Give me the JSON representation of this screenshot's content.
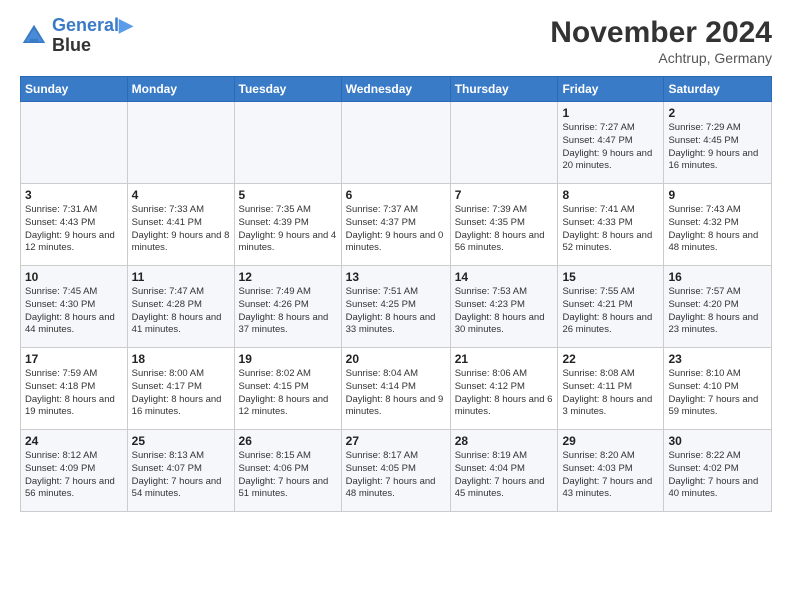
{
  "header": {
    "logo_line1": "General",
    "logo_line2": "Blue",
    "month": "November 2024",
    "location": "Achtrup, Germany"
  },
  "columns": [
    "Sunday",
    "Monday",
    "Tuesday",
    "Wednesday",
    "Thursday",
    "Friday",
    "Saturday"
  ],
  "weeks": [
    [
      {
        "day": "",
        "info": ""
      },
      {
        "day": "",
        "info": ""
      },
      {
        "day": "",
        "info": ""
      },
      {
        "day": "",
        "info": ""
      },
      {
        "day": "",
        "info": ""
      },
      {
        "day": "1",
        "info": "Sunrise: 7:27 AM\nSunset: 4:47 PM\nDaylight: 9 hours and 20 minutes."
      },
      {
        "day": "2",
        "info": "Sunrise: 7:29 AM\nSunset: 4:45 PM\nDaylight: 9 hours and 16 minutes."
      }
    ],
    [
      {
        "day": "3",
        "info": "Sunrise: 7:31 AM\nSunset: 4:43 PM\nDaylight: 9 hours and 12 minutes."
      },
      {
        "day": "4",
        "info": "Sunrise: 7:33 AM\nSunset: 4:41 PM\nDaylight: 9 hours and 8 minutes."
      },
      {
        "day": "5",
        "info": "Sunrise: 7:35 AM\nSunset: 4:39 PM\nDaylight: 9 hours and 4 minutes."
      },
      {
        "day": "6",
        "info": "Sunrise: 7:37 AM\nSunset: 4:37 PM\nDaylight: 9 hours and 0 minutes."
      },
      {
        "day": "7",
        "info": "Sunrise: 7:39 AM\nSunset: 4:35 PM\nDaylight: 8 hours and 56 minutes."
      },
      {
        "day": "8",
        "info": "Sunrise: 7:41 AM\nSunset: 4:33 PM\nDaylight: 8 hours and 52 minutes."
      },
      {
        "day": "9",
        "info": "Sunrise: 7:43 AM\nSunset: 4:32 PM\nDaylight: 8 hours and 48 minutes."
      }
    ],
    [
      {
        "day": "10",
        "info": "Sunrise: 7:45 AM\nSunset: 4:30 PM\nDaylight: 8 hours and 44 minutes."
      },
      {
        "day": "11",
        "info": "Sunrise: 7:47 AM\nSunset: 4:28 PM\nDaylight: 8 hours and 41 minutes."
      },
      {
        "day": "12",
        "info": "Sunrise: 7:49 AM\nSunset: 4:26 PM\nDaylight: 8 hours and 37 minutes."
      },
      {
        "day": "13",
        "info": "Sunrise: 7:51 AM\nSunset: 4:25 PM\nDaylight: 8 hours and 33 minutes."
      },
      {
        "day": "14",
        "info": "Sunrise: 7:53 AM\nSunset: 4:23 PM\nDaylight: 8 hours and 30 minutes."
      },
      {
        "day": "15",
        "info": "Sunrise: 7:55 AM\nSunset: 4:21 PM\nDaylight: 8 hours and 26 minutes."
      },
      {
        "day": "16",
        "info": "Sunrise: 7:57 AM\nSunset: 4:20 PM\nDaylight: 8 hours and 23 minutes."
      }
    ],
    [
      {
        "day": "17",
        "info": "Sunrise: 7:59 AM\nSunset: 4:18 PM\nDaylight: 8 hours and 19 minutes."
      },
      {
        "day": "18",
        "info": "Sunrise: 8:00 AM\nSunset: 4:17 PM\nDaylight: 8 hours and 16 minutes."
      },
      {
        "day": "19",
        "info": "Sunrise: 8:02 AM\nSunset: 4:15 PM\nDaylight: 8 hours and 12 minutes."
      },
      {
        "day": "20",
        "info": "Sunrise: 8:04 AM\nSunset: 4:14 PM\nDaylight: 8 hours and 9 minutes."
      },
      {
        "day": "21",
        "info": "Sunrise: 8:06 AM\nSunset: 4:12 PM\nDaylight: 8 hours and 6 minutes."
      },
      {
        "day": "22",
        "info": "Sunrise: 8:08 AM\nSunset: 4:11 PM\nDaylight: 8 hours and 3 minutes."
      },
      {
        "day": "23",
        "info": "Sunrise: 8:10 AM\nSunset: 4:10 PM\nDaylight: 7 hours and 59 minutes."
      }
    ],
    [
      {
        "day": "24",
        "info": "Sunrise: 8:12 AM\nSunset: 4:09 PM\nDaylight: 7 hours and 56 minutes."
      },
      {
        "day": "25",
        "info": "Sunrise: 8:13 AM\nSunset: 4:07 PM\nDaylight: 7 hours and 54 minutes."
      },
      {
        "day": "26",
        "info": "Sunrise: 8:15 AM\nSunset: 4:06 PM\nDaylight: 7 hours and 51 minutes."
      },
      {
        "day": "27",
        "info": "Sunrise: 8:17 AM\nSunset: 4:05 PM\nDaylight: 7 hours and 48 minutes."
      },
      {
        "day": "28",
        "info": "Sunrise: 8:19 AM\nSunset: 4:04 PM\nDaylight: 7 hours and 45 minutes."
      },
      {
        "day": "29",
        "info": "Sunrise: 8:20 AM\nSunset: 4:03 PM\nDaylight: 7 hours and 43 minutes."
      },
      {
        "day": "30",
        "info": "Sunrise: 8:22 AM\nSunset: 4:02 PM\nDaylight: 7 hours and 40 minutes."
      }
    ]
  ]
}
